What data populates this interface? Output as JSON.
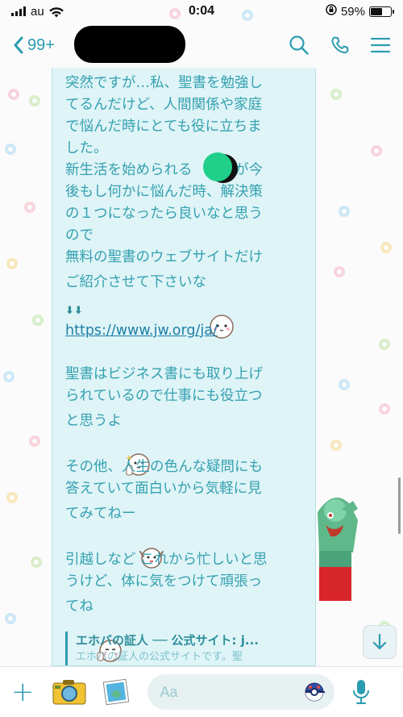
{
  "status_bar": {
    "carrier": "au",
    "time": "0:04",
    "battery_percent": "59%",
    "battery_level": 0.59
  },
  "header": {
    "unread_count": "99+",
    "icons": [
      "back-chevron-icon",
      "search-icon",
      "phone-icon",
      "menu-icon"
    ]
  },
  "message": {
    "paragraph1": "突然ですが…私、聖書を勉強し\nてるんだけど、人間関係や家庭\nで悩んだ時にとても役に立ちま\nした。\n新生活を始められる　　君が今\n後もし何かに悩んだ時、解決策\nの１つになったら良いなと思う\nので\n無料の聖書のウェブサイトだけ\nご紹介させて下さいな",
    "arrows": "⬇⬇",
    "link": "https://www.jw.org/ja/",
    "paragraph2": "聖書はビジネス書にも取り上げ\nられているので仕事にも役立つ\nと思うよ",
    "paragraph3": "その他、人生の色んな疑問にも\n答えていて面白いから気軽に見\nてみてねー",
    "paragraph4": "引越しなど これから忙しいと思\nうけど、体に気をつけて頑張っ\nてね",
    "preview_title": "エホバの証人 ── 公式サイト: j...",
    "preview_desc": "エホバの証人の公式サイトです。聖"
  },
  "input_bar": {
    "placeholder": "Aa"
  },
  "colors": {
    "accent": "#2b9cb0",
    "bubble_bg": "#dff4f7",
    "text": "#34a1b0"
  }
}
